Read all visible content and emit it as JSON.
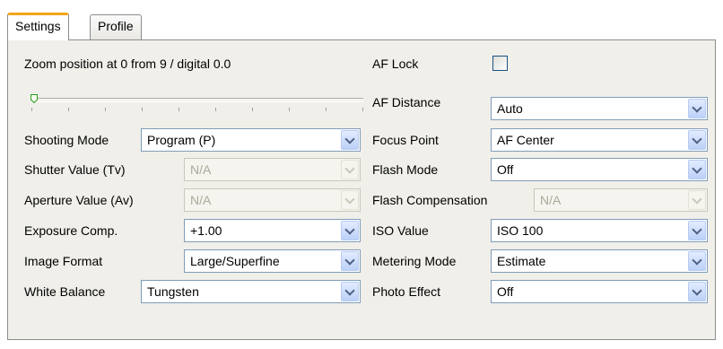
{
  "tabs": [
    {
      "label": "Settings",
      "active": true
    },
    {
      "label": "Profile",
      "active": false
    }
  ],
  "zoom": {
    "label": "Zoom position at 0 from 9 / digital 0.0",
    "position": 0,
    "max": 9
  },
  "left_settings": [
    {
      "label": "Shooting Mode",
      "value": "Program (P)",
      "enabled": true
    },
    {
      "label": "Shutter Value (Tv)",
      "value": "N/A",
      "enabled": false
    },
    {
      "label": "Aperture Value (Av)",
      "value": "N/A",
      "enabled": false
    },
    {
      "label": "Exposure Comp.",
      "value": "+1.00",
      "enabled": true
    },
    {
      "label": "Image Format",
      "value": "Large/Superfine",
      "enabled": true
    },
    {
      "label": "White Balance",
      "value": "Tungsten",
      "enabled": true
    }
  ],
  "af_lock": {
    "label": "AF Lock",
    "checked": false
  },
  "right_settings": [
    {
      "label": "AF Distance",
      "value": "Auto",
      "enabled": true
    },
    {
      "label": "Focus Point",
      "value": "AF Center",
      "enabled": true
    },
    {
      "label": "Flash Mode",
      "value": "Off",
      "enabled": true
    },
    {
      "label": "Flash Compensation",
      "value": "N/A",
      "enabled": false
    },
    {
      "label": "ISO Value",
      "value": "ISO 100",
      "enabled": true
    },
    {
      "label": "Metering Mode",
      "value": "Estimate",
      "enabled": true
    },
    {
      "label": "Photo Effect",
      "value": "Off",
      "enabled": true
    }
  ],
  "colors": {
    "active_tab_accent": "#f3a51a",
    "panel_background": "#f0efea",
    "disabled_text": "#aca899",
    "dropdown_arrow": "#bcd0f7"
  },
  "icons": {
    "dropdown": "chevron-down-icon",
    "slider_thumb": "slider-thumb-icon"
  }
}
